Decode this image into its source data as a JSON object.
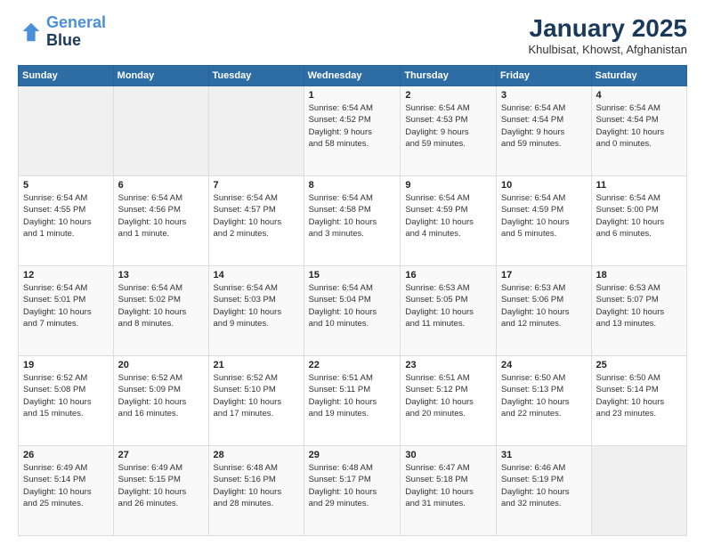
{
  "logo": {
    "line1": "General",
    "line2": "Blue"
  },
  "title": "January 2025",
  "subtitle": "Khulbisat, Khowst, Afghanistan",
  "weekdays": [
    "Sunday",
    "Monday",
    "Tuesday",
    "Wednesday",
    "Thursday",
    "Friday",
    "Saturday"
  ],
  "weeks": [
    [
      {
        "day": "",
        "info": ""
      },
      {
        "day": "",
        "info": ""
      },
      {
        "day": "",
        "info": ""
      },
      {
        "day": "1",
        "info": "Sunrise: 6:54 AM\nSunset: 4:52 PM\nDaylight: 9 hours\nand 58 minutes."
      },
      {
        "day": "2",
        "info": "Sunrise: 6:54 AM\nSunset: 4:53 PM\nDaylight: 9 hours\nand 59 minutes."
      },
      {
        "day": "3",
        "info": "Sunrise: 6:54 AM\nSunset: 4:54 PM\nDaylight: 9 hours\nand 59 minutes."
      },
      {
        "day": "4",
        "info": "Sunrise: 6:54 AM\nSunset: 4:54 PM\nDaylight: 10 hours\nand 0 minutes."
      }
    ],
    [
      {
        "day": "5",
        "info": "Sunrise: 6:54 AM\nSunset: 4:55 PM\nDaylight: 10 hours\nand 1 minute."
      },
      {
        "day": "6",
        "info": "Sunrise: 6:54 AM\nSunset: 4:56 PM\nDaylight: 10 hours\nand 1 minute."
      },
      {
        "day": "7",
        "info": "Sunrise: 6:54 AM\nSunset: 4:57 PM\nDaylight: 10 hours\nand 2 minutes."
      },
      {
        "day": "8",
        "info": "Sunrise: 6:54 AM\nSunset: 4:58 PM\nDaylight: 10 hours\nand 3 minutes."
      },
      {
        "day": "9",
        "info": "Sunrise: 6:54 AM\nSunset: 4:59 PM\nDaylight: 10 hours\nand 4 minutes."
      },
      {
        "day": "10",
        "info": "Sunrise: 6:54 AM\nSunset: 4:59 PM\nDaylight: 10 hours\nand 5 minutes."
      },
      {
        "day": "11",
        "info": "Sunrise: 6:54 AM\nSunset: 5:00 PM\nDaylight: 10 hours\nand 6 minutes."
      }
    ],
    [
      {
        "day": "12",
        "info": "Sunrise: 6:54 AM\nSunset: 5:01 PM\nDaylight: 10 hours\nand 7 minutes."
      },
      {
        "day": "13",
        "info": "Sunrise: 6:54 AM\nSunset: 5:02 PM\nDaylight: 10 hours\nand 8 minutes."
      },
      {
        "day": "14",
        "info": "Sunrise: 6:54 AM\nSunset: 5:03 PM\nDaylight: 10 hours\nand 9 minutes."
      },
      {
        "day": "15",
        "info": "Sunrise: 6:54 AM\nSunset: 5:04 PM\nDaylight: 10 hours\nand 10 minutes."
      },
      {
        "day": "16",
        "info": "Sunrise: 6:53 AM\nSunset: 5:05 PM\nDaylight: 10 hours\nand 11 minutes."
      },
      {
        "day": "17",
        "info": "Sunrise: 6:53 AM\nSunset: 5:06 PM\nDaylight: 10 hours\nand 12 minutes."
      },
      {
        "day": "18",
        "info": "Sunrise: 6:53 AM\nSunset: 5:07 PM\nDaylight: 10 hours\nand 13 minutes."
      }
    ],
    [
      {
        "day": "19",
        "info": "Sunrise: 6:52 AM\nSunset: 5:08 PM\nDaylight: 10 hours\nand 15 minutes."
      },
      {
        "day": "20",
        "info": "Sunrise: 6:52 AM\nSunset: 5:09 PM\nDaylight: 10 hours\nand 16 minutes."
      },
      {
        "day": "21",
        "info": "Sunrise: 6:52 AM\nSunset: 5:10 PM\nDaylight: 10 hours\nand 17 minutes."
      },
      {
        "day": "22",
        "info": "Sunrise: 6:51 AM\nSunset: 5:11 PM\nDaylight: 10 hours\nand 19 minutes."
      },
      {
        "day": "23",
        "info": "Sunrise: 6:51 AM\nSunset: 5:12 PM\nDaylight: 10 hours\nand 20 minutes."
      },
      {
        "day": "24",
        "info": "Sunrise: 6:50 AM\nSunset: 5:13 PM\nDaylight: 10 hours\nand 22 minutes."
      },
      {
        "day": "25",
        "info": "Sunrise: 6:50 AM\nSunset: 5:14 PM\nDaylight: 10 hours\nand 23 minutes."
      }
    ],
    [
      {
        "day": "26",
        "info": "Sunrise: 6:49 AM\nSunset: 5:14 PM\nDaylight: 10 hours\nand 25 minutes."
      },
      {
        "day": "27",
        "info": "Sunrise: 6:49 AM\nSunset: 5:15 PM\nDaylight: 10 hours\nand 26 minutes."
      },
      {
        "day": "28",
        "info": "Sunrise: 6:48 AM\nSunset: 5:16 PM\nDaylight: 10 hours\nand 28 minutes."
      },
      {
        "day": "29",
        "info": "Sunrise: 6:48 AM\nSunset: 5:17 PM\nDaylight: 10 hours\nand 29 minutes."
      },
      {
        "day": "30",
        "info": "Sunrise: 6:47 AM\nSunset: 5:18 PM\nDaylight: 10 hours\nand 31 minutes."
      },
      {
        "day": "31",
        "info": "Sunrise: 6:46 AM\nSunset: 5:19 PM\nDaylight: 10 hours\nand 32 minutes."
      },
      {
        "day": "",
        "info": ""
      }
    ]
  ]
}
